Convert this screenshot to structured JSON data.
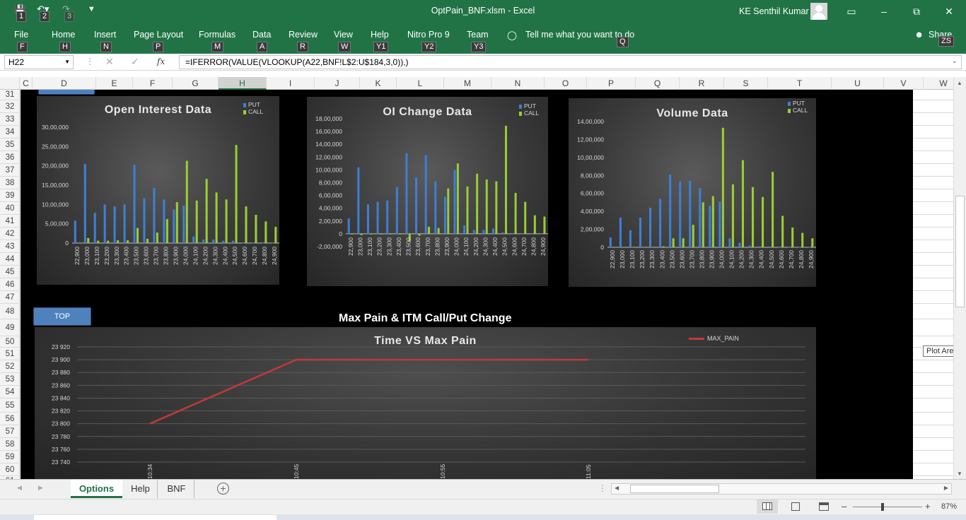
{
  "titlebar": {
    "document_title": "OptPain_BNF.xlsm  -  Excel",
    "user_name": "KE Senthil Kumar",
    "qat_keytips": [
      "1",
      "2",
      "3"
    ]
  },
  "ribbon": {
    "tabs": [
      {
        "label": "File",
        "keytip": "F"
      },
      {
        "label": "Home",
        "keytip": "H"
      },
      {
        "label": "Insert",
        "keytip": "N"
      },
      {
        "label": "Page Layout",
        "keytip": "P"
      },
      {
        "label": "Formulas",
        "keytip": "M"
      },
      {
        "label": "Data",
        "keytip": "A"
      },
      {
        "label": "Review",
        "keytip": "R"
      },
      {
        "label": "View",
        "keytip": "W"
      },
      {
        "label": "Help",
        "keytip": "Y1"
      },
      {
        "label": "Nitro Pro 9",
        "keytip": "Y2"
      },
      {
        "label": "Team",
        "keytip": "Y3"
      }
    ],
    "tell_me": "Tell me what you want to do",
    "tell_me_keytip": "Q",
    "share": "Share",
    "share_keytip": "ZS"
  },
  "formula_bar": {
    "name_box": "H22",
    "fx": "fx",
    "formula": "=IFERROR(VALUE(VLOOKUP(A22,BNF!L$2:U$184,3,0)),)"
  },
  "columns": [
    "C",
    "D",
    "E",
    "F",
    "G",
    "H",
    "I",
    "J",
    "K",
    "L",
    "M",
    "N",
    "O",
    "P",
    "Q",
    "R",
    "S",
    "T",
    "U",
    "V",
    "W"
  ],
  "rows": [
    "31",
    "32",
    "33",
    "34",
    "35",
    "36",
    "37",
    "38",
    "39",
    "40",
    "41",
    "42",
    "43",
    "44",
    "45",
    "46",
    "47",
    "48",
    "49",
    "50",
    "51",
    "52",
    "53",
    "54",
    "55",
    "56",
    "57",
    "58",
    "59",
    "60",
    "61"
  ],
  "sheet": {
    "top_button": "TOP",
    "section_title": "Max Pain & ITM Call/Put Change"
  },
  "legend": {
    "put": "PUT",
    "call": "CALL",
    "max_pain": "MAX_PAIN"
  },
  "colors": {
    "put": "#3d7fd6",
    "call": "#9acd32",
    "max_pain": "#c0393b",
    "excel_green": "#217346"
  },
  "chart_data": [
    {
      "type": "bar",
      "title": "Open Interest Data",
      "categories": [
        "22,900",
        "23,000",
        "23,100",
        "23,200",
        "23,300",
        "23,400",
        "23,500",
        "23,600",
        "23,700",
        "23,800",
        "23,900",
        "24,000",
        "24,100",
        "24,200",
        "24,300",
        "24,400",
        "24,500",
        "24,600",
        "24,700",
        "24,800",
        "24,900"
      ],
      "series": [
        {
          "name": "PUT",
          "values": [
            580000,
            2050000,
            780000,
            1000000,
            950000,
            1000000,
            2030000,
            1160000,
            1430000,
            1130000,
            870000,
            970000,
            170000,
            90000,
            90000,
            60000,
            60000,
            0,
            0,
            0,
            0
          ]
        },
        {
          "name": "CALL",
          "values": [
            10000,
            130000,
            60000,
            60000,
            70000,
            70000,
            390000,
            110000,
            270000,
            620000,
            1060000,
            2130000,
            1100000,
            1660000,
            1310000,
            1130000,
            2540000,
            950000,
            730000,
            560000,
            420000
          ]
        }
      ],
      "ylim": [
        0,
        3000000
      ],
      "yticks": [
        "0",
        "5,00,000",
        "10,00,000",
        "15,00,000",
        "20,00,000",
        "25,00,000",
        "30,00,000"
      ],
      "legend_position": "top-right"
    },
    {
      "type": "bar",
      "title": "OI Change Data",
      "categories": [
        "22,900",
        "23,000",
        "23,100",
        "23,200",
        "23,300",
        "23,400",
        "23,500",
        "23,600",
        "23,700",
        "23,800",
        "23,900",
        "24,000",
        "24,100",
        "24,200",
        "24,300",
        "24,400",
        "24,500",
        "24,600",
        "24,700",
        "24,800",
        "24,900"
      ],
      "series": [
        {
          "name": "PUT",
          "values": [
            240000,
            1040000,
            460000,
            500000,
            520000,
            730000,
            1260000,
            880000,
            1230000,
            820000,
            580000,
            1000000,
            130000,
            60000,
            60000,
            80000,
            20000,
            0,
            0,
            0,
            0
          ]
        },
        {
          "name": "CALL",
          "values": [
            -10000,
            -20000,
            -10000,
            -10000,
            -10000,
            -10000,
            -120000,
            -30000,
            110000,
            90000,
            710000,
            1100000,
            740000,
            940000,
            850000,
            820000,
            1690000,
            640000,
            500000,
            290000,
            270000
          ]
        }
      ],
      "ylim": [
        -200000,
        1800000
      ],
      "yticks": [
        "-2,00,000",
        "0",
        "2,00,000",
        "4,00,000",
        "6,00,000",
        "8,00,000",
        "10,00,000",
        "12,00,000",
        "14,00,000",
        "16,00,000",
        "18,00,000"
      ],
      "legend_position": "top-right"
    },
    {
      "type": "bar",
      "title": "Volume Data",
      "categories": [
        "22,900",
        "23,000",
        "23,100",
        "23,200",
        "23,300",
        "23,400",
        "23,500",
        "23,600",
        "23,700",
        "23,800",
        "23,900",
        "24,000",
        "24,100",
        "24,200",
        "24,300",
        "24,400",
        "24,500",
        "24,600",
        "24,700",
        "24,800",
        "24,900"
      ],
      "series": [
        {
          "name": "PUT",
          "values": [
            110000,
            330000,
            190000,
            330000,
            440000,
            540000,
            810000,
            730000,
            740000,
            660000,
            460000,
            510000,
            100000,
            50000,
            20000,
            10000,
            10000,
            0,
            0,
            0,
            0
          ]
        },
        {
          "name": "CALL",
          "values": [
            0,
            0,
            0,
            0,
            0,
            10000,
            100000,
            100000,
            250000,
            500000,
            570000,
            1330000,
            700000,
            970000,
            670000,
            560000,
            840000,
            350000,
            220000,
            160000,
            100000
          ]
        }
      ],
      "ylim": [
        0,
        1400000
      ],
      "yticks": [
        "0",
        "2,00,000",
        "4,00,000",
        "6,00,000",
        "8,00,000",
        "10,00,000",
        "12,00,000",
        "14,00,000"
      ],
      "legend_position": "top-right"
    },
    {
      "type": "line",
      "title": "Time VS Max Pain",
      "x": [
        "10:34",
        "10:45",
        "10:55",
        "11:05"
      ],
      "series": [
        {
          "name": "MAX_PAIN",
          "values": [
            23800,
            23900,
            23900,
            23900
          ]
        }
      ],
      "ylim": [
        23740,
        23920
      ],
      "yticks": [
        "23 740",
        "23 760",
        "23 780",
        "23 800",
        "23 820",
        "23 840",
        "23 860",
        "23 880",
        "23 900",
        "23 920"
      ],
      "legend_position": "top-right",
      "grid": true
    }
  ],
  "tooltip": "Plot Area",
  "sheet_tabs": [
    "Options",
    "Help",
    "BNF"
  ],
  "active_sheet": "Options",
  "status": {
    "zoom": "87%"
  }
}
